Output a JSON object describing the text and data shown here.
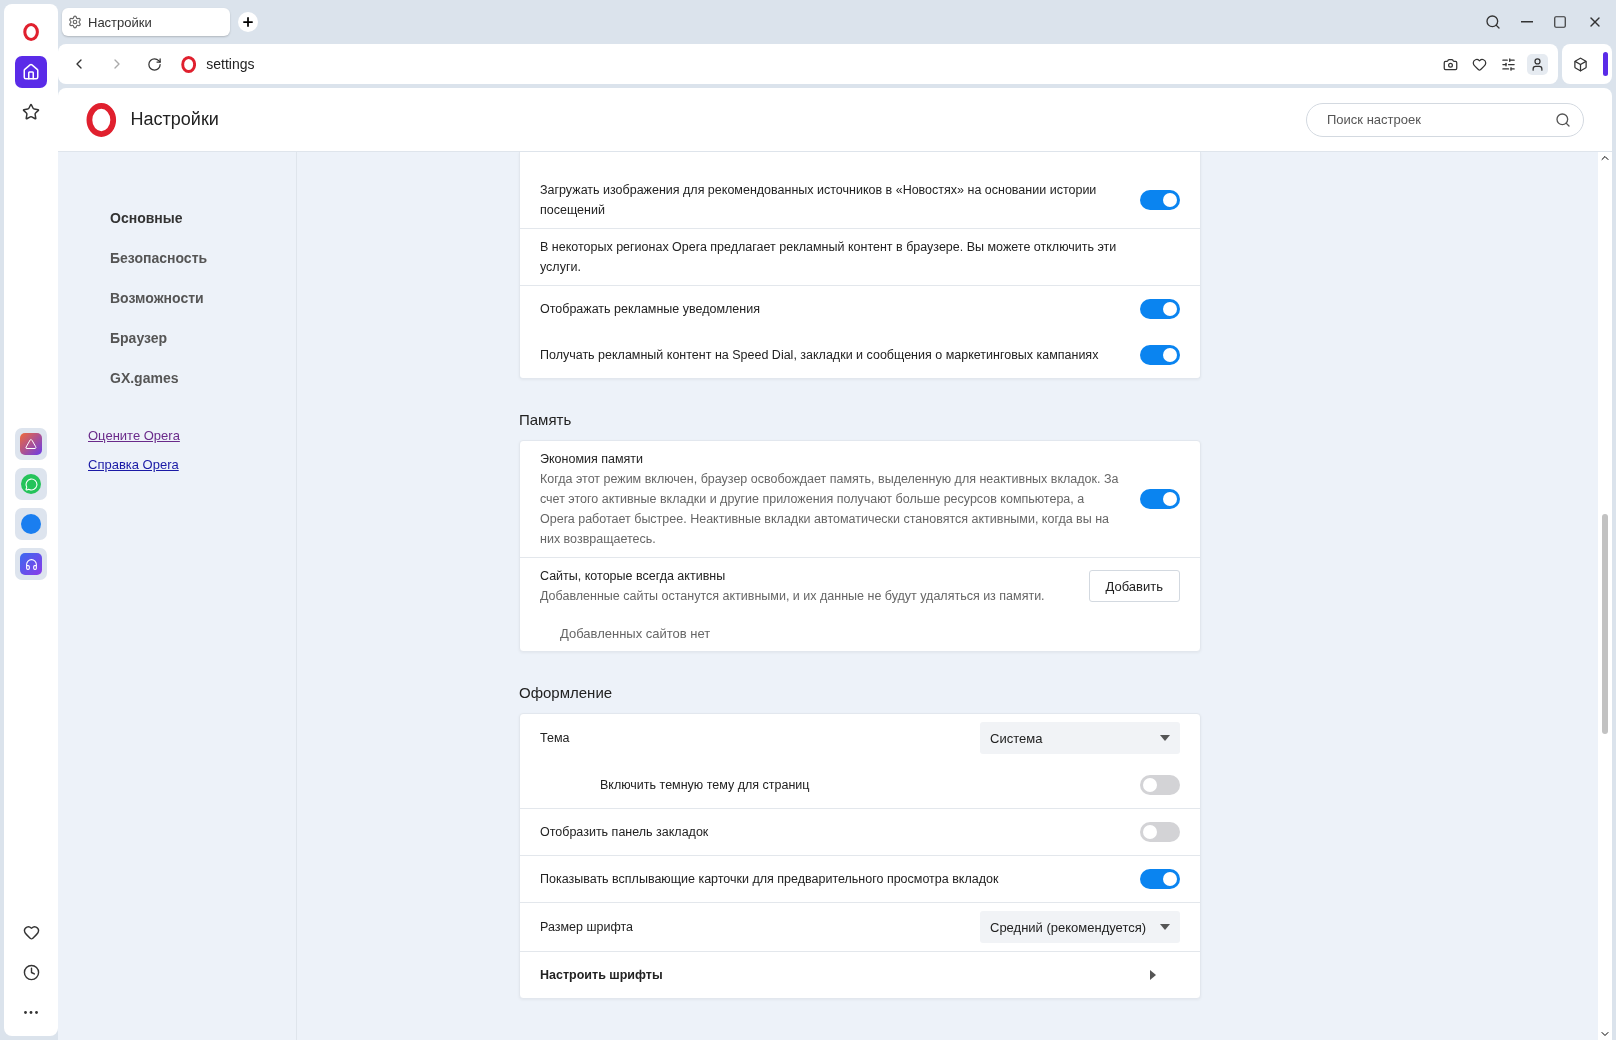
{
  "tab": {
    "title": "Настройки"
  },
  "address": "settings",
  "header": {
    "title": "Настройки",
    "search_placeholder": "Поиск настроек"
  },
  "nav": [
    {
      "label": "Основные",
      "selected": true
    },
    {
      "label": "Безопасность",
      "selected": false
    },
    {
      "label": "Возможности",
      "selected": false
    },
    {
      "label": "Браузер",
      "selected": false
    },
    {
      "label": "GX.games",
      "selected": false
    }
  ],
  "links": [
    {
      "label": "Оцените Opera",
      "visited": true
    },
    {
      "label": "Справка Opera",
      "visited": false
    }
  ],
  "sections": [
    {
      "groups": [
        [
          {
            "kind": "toggle",
            "label": "Загружать изображения для рекомендованных источников в «Новостях» на основании истории посещений",
            "on": true,
            "indented": false
          }
        ],
        [
          {
            "kind": "text",
            "label": "В некоторых регионах Opera предлагает рекламный контент в браузере. Вы можете отключить эти услуги."
          }
        ],
        [
          {
            "kind": "toggle",
            "label": "Отображать рекламные уведомления",
            "on": true,
            "indented": false
          },
          {
            "kind": "toggle",
            "label": "Получать рекламный контент на Speed Dial, закладки и сообщения о маркетинговых кампаниях",
            "on": true,
            "indented": false
          }
        ]
      ]
    },
    {
      "title": "Память",
      "groups": [
        [
          {
            "kind": "toggle",
            "label": "Экономия памяти",
            "description": "Когда этот режим включен, браузер освобождает память, выделенную для неактивных вкладок. За счет этого активные вкладки и другие приложения получают больше ресурсов компьютера, а Opera работает быстрее. Неактивные вкладки автоматически становятся активными, когда вы на них возвращаетесь.",
            "on": true,
            "indented": false
          }
        ],
        [
          {
            "kind": "button",
            "label": "Сайты, которые всегда активны",
            "description": "Добавленные сайты останутся активными, и их данные не будут удаляться из памяти.",
            "button": "Добавить",
            "note": "Добавленных сайтов нет"
          }
        ]
      ]
    },
    {
      "title": "Оформление",
      "groups": [
        [
          {
            "kind": "select",
            "label": "Тема",
            "value": "Система"
          },
          {
            "kind": "toggle",
            "label": "Включить темную тему для страниц",
            "on": false,
            "indented": true
          }
        ],
        [
          {
            "kind": "toggle",
            "label": "Отобразить панель закладок",
            "on": false,
            "indented": false
          }
        ],
        [
          {
            "kind": "toggle",
            "label": "Показывать всплывающие карточки для предварительного просмотра вкладок",
            "on": true,
            "indented": false
          }
        ],
        [
          {
            "kind": "select",
            "label": "Размер шрифта",
            "value": "Средний (рекомендуется)"
          }
        ],
        [
          {
            "kind": "link",
            "label": "Настроить шрифты"
          }
        ]
      ]
    }
  ]
}
